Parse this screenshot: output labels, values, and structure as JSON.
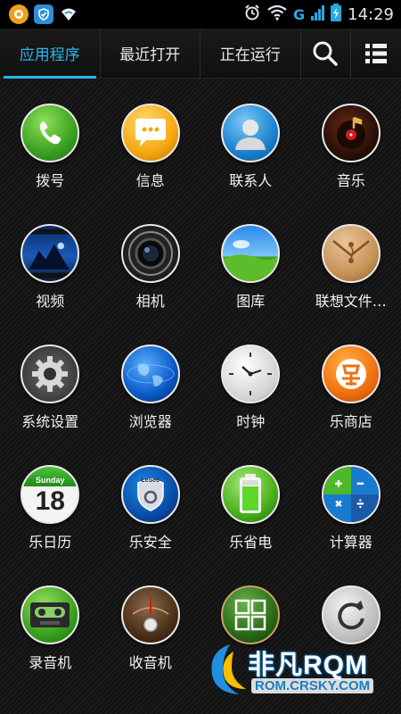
{
  "status_bar": {
    "time": "14:29",
    "network": "G",
    "icons": [
      "baidu-icon",
      "shield-icon",
      "wifi-upload-icon",
      "alarm-icon",
      "wifi-icon",
      "signal-icon",
      "battery-icon"
    ]
  },
  "tabs": [
    {
      "label": "应用程序",
      "active": true
    },
    {
      "label": "最近打开",
      "active": false
    },
    {
      "label": "正在运行",
      "active": false
    }
  ],
  "apps": [
    {
      "label": "拨号",
      "icon": "phone-icon"
    },
    {
      "label": "信息",
      "icon": "message-icon"
    },
    {
      "label": "联系人",
      "icon": "contacts-icon"
    },
    {
      "label": "音乐",
      "icon": "music-icon"
    },
    {
      "label": "视频",
      "icon": "video-icon"
    },
    {
      "label": "相机",
      "icon": "camera-icon"
    },
    {
      "label": "图库",
      "icon": "gallery-icon"
    },
    {
      "label": "联想文件…",
      "icon": "file-manager-icon"
    },
    {
      "label": "系统设置",
      "icon": "settings-icon"
    },
    {
      "label": "浏览器",
      "icon": "browser-icon"
    },
    {
      "label": "时钟",
      "icon": "clock-icon"
    },
    {
      "label": "乐商店",
      "icon": "app-store-icon"
    },
    {
      "label": "乐日历",
      "icon": "calendar-icon"
    },
    {
      "label": "乐安全",
      "icon": "security-icon"
    },
    {
      "label": "乐省电",
      "icon": "battery-saver-icon"
    },
    {
      "label": "计算器",
      "icon": "calculator-icon"
    },
    {
      "label": "录音机",
      "icon": "recorder-icon"
    },
    {
      "label": "收音机",
      "icon": "radio-icon"
    },
    {
      "label": "",
      "icon": "widget-icon"
    },
    {
      "label": "",
      "icon": "backup-icon"
    }
  ],
  "calendar_icon": {
    "weekday": "Sunday",
    "day": "18"
  },
  "security_icon_text": "LeSec",
  "watermark": {
    "title": "非凡RQM",
    "url": "ROM.CRSKY.COM"
  },
  "colors": {
    "accent": "#27b6e8"
  }
}
